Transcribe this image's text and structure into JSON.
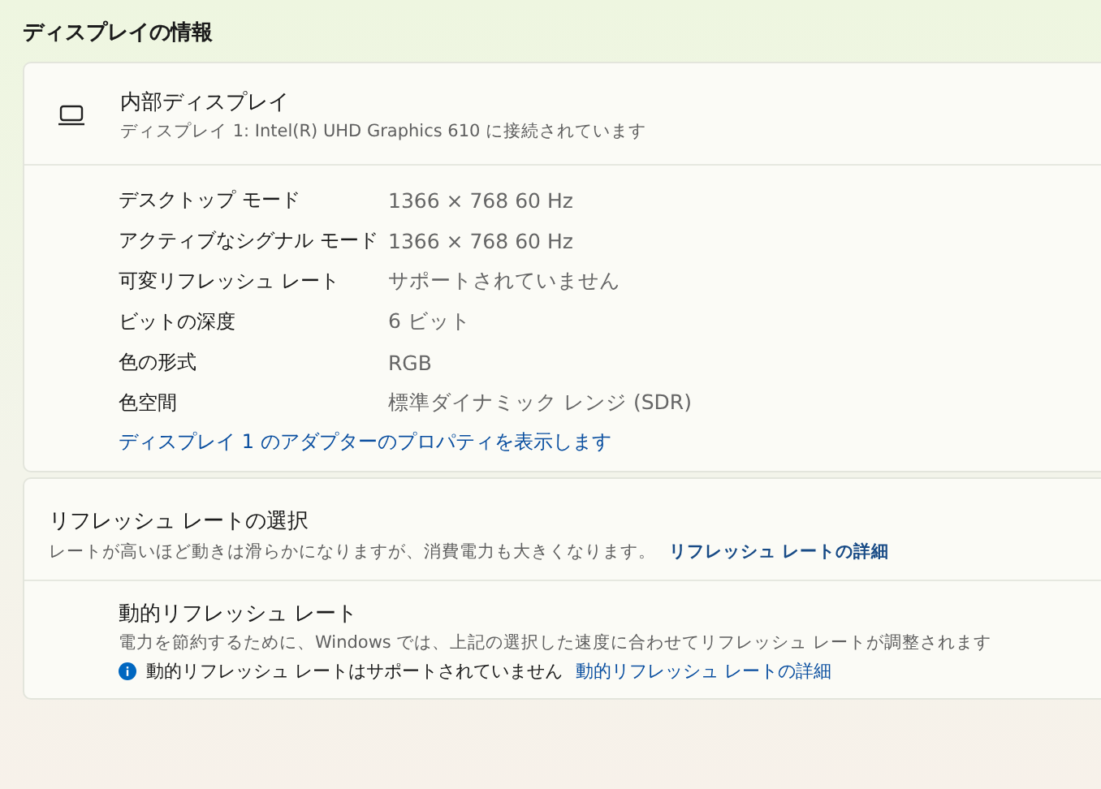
{
  "section_title": "ディスプレイの情報",
  "display": {
    "name": "内部ディスプレイ",
    "subtitle": "ディスプレイ 1: Intel(R) UHD Graphics 610 に接続されています"
  },
  "details": [
    {
      "label": "デスクトップ モード",
      "value": "1366 × 768 60 Hz"
    },
    {
      "label": "アクティブなシグナル モード",
      "value": "1366 × 768 60 Hz"
    },
    {
      "label": "可変リフレッシュ レート",
      "value": "サポートされていません"
    },
    {
      "label": "ビットの深度",
      "value": "6 ビット"
    },
    {
      "label": "色の形式",
      "value": "RGB"
    },
    {
      "label": "色空間",
      "value": "標準ダイナミック レンジ (SDR)"
    }
  ],
  "adapter_link": "ディスプレイ 1 のアダプターのプロパティを表示します",
  "refresh": {
    "title": "リフレッシュ レートの選択",
    "description": "レートが高いほど動きは滑らかになりますが、消費電力も大きくなります。",
    "link": "リフレッシュ レートの詳細"
  },
  "dynamic": {
    "title": "動的リフレッシュ レート",
    "description": "電力を節約するために、Windows では、上記の選択した速度に合わせてリフレッシュ レートが調整されます",
    "notice": "動的リフレッシュ レートはサポートされていません",
    "link": "動的リフレッシュ レートの詳細"
  }
}
